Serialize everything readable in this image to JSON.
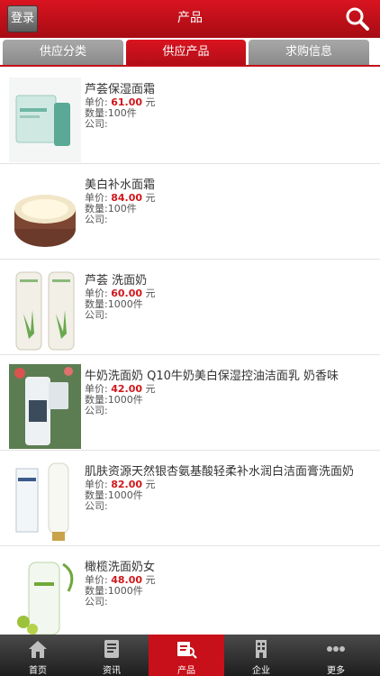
{
  "header": {
    "login_label": "登录",
    "title": "产品"
  },
  "tabs": [
    {
      "label": "供应分类"
    },
    {
      "label": "供应产品"
    },
    {
      "label": "求购信息"
    }
  ],
  "labels": {
    "unit_price": "单价:",
    "currency": "元",
    "quantity": "数量:",
    "company": "公司:"
  },
  "products": [
    {
      "name": "芦荟保湿面霜",
      "price": "61.00",
      "quantity": "100件"
    },
    {
      "name": "美白补水面霜",
      "price": "84.00",
      "quantity": "100件"
    },
    {
      "name": "芦荟 洗面奶",
      "price": "60.00",
      "quantity": "1000件"
    },
    {
      "name": "牛奶洗面奶 Q10牛奶美白保湿控油洁面乳 奶香味",
      "price": "42.00",
      "quantity": "1000件"
    },
    {
      "name": "肌肤资源天然银杏氨基酸轻柔补水润白洁面膏洗面奶",
      "price": "82.00",
      "quantity": "1000件"
    },
    {
      "name": "橄榄洗面奶女",
      "price": "48.00",
      "quantity": "1000件"
    }
  ],
  "tabbar": [
    {
      "label": "首页",
      "icon": "home-icon"
    },
    {
      "label": "资讯",
      "icon": "news-icon"
    },
    {
      "label": "产品",
      "icon": "product-icon"
    },
    {
      "label": "企业",
      "icon": "building-icon"
    },
    {
      "label": "更多",
      "icon": "more-icon"
    }
  ],
  "colors": {
    "brand_red": "#c8101a",
    "price_red": "#d0181c",
    "tab_gray": "#999999"
  }
}
